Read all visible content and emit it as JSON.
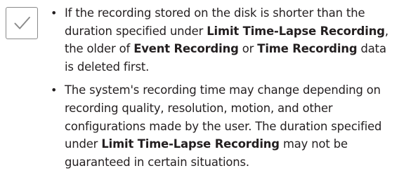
{
  "note": {
    "icon": "check-icon",
    "bullet_char": "•",
    "items": [
      {
        "segments": [
          {
            "text": "If the recording stored on the disk is shorter than the duration specified under ",
            "bold": false
          },
          {
            "text": "Limit Time-Lapse Recording",
            "bold": true
          },
          {
            "text": ", the older of ",
            "bold": false
          },
          {
            "text": "Event Recording",
            "bold": true
          },
          {
            "text": " or ",
            "bold": false
          },
          {
            "text": "Time Recording",
            "bold": true
          },
          {
            "text": " data is deleted first.",
            "bold": false
          }
        ]
      },
      {
        "segments": [
          {
            "text": "The system's recording time may change depending on recording quality, resolution, motion, and other configurations made by the user. The duration specified under ",
            "bold": false
          },
          {
            "text": "Limit Time-Lapse Recording",
            "bold": true
          },
          {
            "text": " may not be guaranteed in certain situations.",
            "bold": false
          }
        ]
      }
    ]
  }
}
